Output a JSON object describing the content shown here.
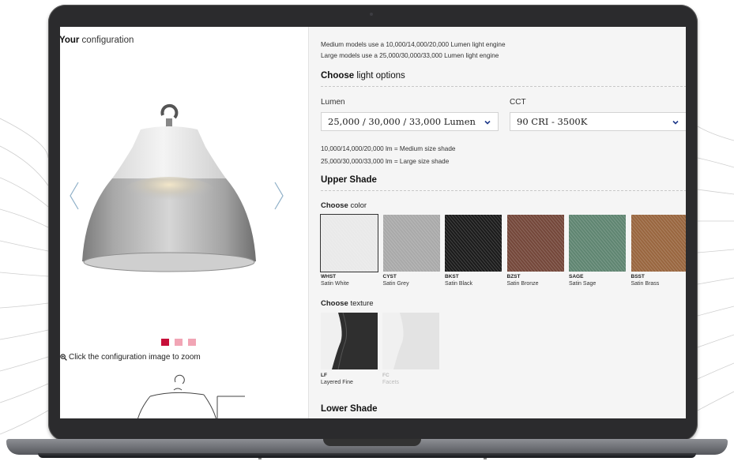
{
  "configuration": {
    "title_bold": "Your",
    "title_rest": "configuration",
    "zoom_hint": "Click the configuration image to zoom",
    "carousel_dot_count": 3,
    "carousel_active_index": 0
  },
  "options": {
    "engine_note_medium": "Medium models use a 10,000/14,000/20,000 Lumen light engine",
    "engine_note_large": "Large models use a 25,000/30,000/33,000 Lumen light engine",
    "light_options_title_bold": "Choose",
    "light_options_title_rest": "light options",
    "lumen_label": "Lumen",
    "lumen_value": "25,000 / 30,000 / 33,000 Lumen",
    "cct_label": "CCT",
    "cct_value": "90 CRI - 3500K",
    "size_note_medium": "10,000/14,000/20,000 lm = Medium size shade",
    "size_note_large": "25,000/30,000/33,000 lm = Large size shade"
  },
  "upper_shade": {
    "title": "Upper Shade",
    "color_title_bold": "Choose",
    "color_title_rest": "color",
    "colors": [
      {
        "code": "WHST",
        "name": "Satin White",
        "color": "#e9e9e9",
        "selected": true
      },
      {
        "code": "CYST",
        "name": "Satin Grey",
        "color": "#a9a9a9",
        "selected": false
      },
      {
        "code": "BKST",
        "name": "Satin Black",
        "color": "#1b1b1b",
        "selected": false
      },
      {
        "code": "BZST",
        "name": "Satin Bronze",
        "color": "#74473a",
        "selected": false
      },
      {
        "code": "SAGE",
        "name": "Satin Sage",
        "color": "#5f8571",
        "selected": false
      },
      {
        "code": "BSST",
        "name": "Satin Brass",
        "color": "#99663f",
        "selected": false
      }
    ],
    "texture_title_bold": "Choose",
    "texture_title_rest": "texture",
    "textures": [
      {
        "code": "LF",
        "name": "Layered Fine",
        "available": true
      },
      {
        "code": "FC",
        "name": "Facets",
        "available": false
      }
    ]
  },
  "lower_shade": {
    "title": "Lower Shade"
  },
  "colors": {
    "accent": "#c70f39",
    "accent_light": "#f1a5b5",
    "panel_bg": "#f5f5f5",
    "laptop_frame": "#2b2b2d"
  },
  "icons": [
    "chevron-left-icon",
    "chevron-right-icon",
    "chevron-down-icon",
    "zoom-icon"
  ]
}
